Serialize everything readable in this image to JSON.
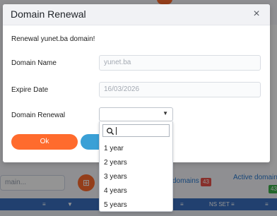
{
  "background": {
    "search_placeholder": "main...",
    "grid_button": "⊞",
    "links": {
      "domains": "domains",
      "domains_count": "43",
      "active_domains": "Active domains",
      "active_count": "43"
    },
    "table_headers": [
      "≡",
      "≡",
      "≡",
      "NS SET ≡",
      "≡"
    ],
    "colors": {
      "accent": "#ff6b2d",
      "link": "#2a7ad0",
      "header": "#3a6fbf",
      "badge_red": "#e8514a",
      "badge_green": "#3bb04b"
    }
  },
  "modal": {
    "title": "Domain Renewal",
    "close_icon": "×",
    "intro": "Renewal yunet.ba domain!",
    "fields": {
      "domain_name_label": "Domain Name",
      "domain_name_value": "yunet.ba",
      "expire_date_label": "Expire Date",
      "expire_date_value": "16/03/2026",
      "renewal_label": "Domain Renewal",
      "renewal_selected": ""
    },
    "ok_label": "Ok"
  },
  "dropdown": {
    "search_value": "",
    "options": [
      "1 year",
      "2 years",
      "3 years",
      "4 years",
      "5 years"
    ]
  }
}
